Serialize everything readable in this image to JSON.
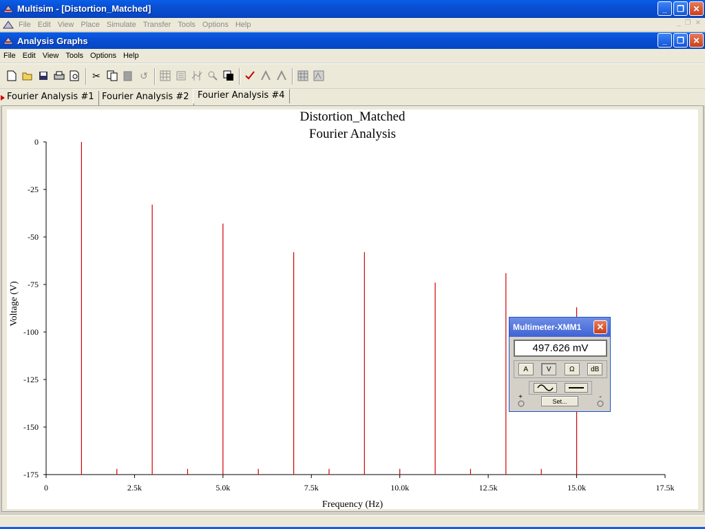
{
  "app": {
    "title": "Multisim - [Distortion_Matched]",
    "menu": [
      "File",
      "Edit",
      "View",
      "Place",
      "Simulate",
      "Transfer",
      "Tools",
      "Options",
      "Help"
    ]
  },
  "graph_window": {
    "title": "Analysis Graphs",
    "menu": [
      "File",
      "Edit",
      "View",
      "Tools",
      "Options",
      "Help"
    ],
    "tabs": [
      "Fourier Analysis #1",
      "Fourier Analysis #2",
      "Fourier Analysis #4"
    ],
    "active_tab": 2
  },
  "toolbar": {
    "buttons": [
      "new-icon",
      "open-icon",
      "save-icon",
      "print-icon",
      "print-preview-icon",
      "cut-icon",
      "copy-icon",
      "paste-icon",
      "undo-icon",
      "grid-icon",
      "legend-icon",
      "cursors-icon",
      "zoom-icon",
      "reverse-colors-icon",
      "overlay-traces-icon",
      "add-trace-icon",
      "remove-trace-icon",
      "export-excel-icon",
      "export-mathcad-icon"
    ]
  },
  "chart_data": {
    "type": "bar",
    "title": "Distortion_Matched",
    "subtitle": "Fourier Analysis",
    "xlabel": "Frequency (Hz)",
    "ylabel": "Voltage (V)",
    "xlim": [
      0,
      17500
    ],
    "ylim": [
      -175,
      0
    ],
    "xticks": [
      0,
      2500,
      5000,
      7500,
      10000,
      12500,
      15000,
      17500
    ],
    "xtick_labels": [
      "0",
      "2.5k",
      "5.0k",
      "7.5k",
      "10.0k",
      "12.5k",
      "15.0k",
      "17.5k"
    ],
    "yticks": [
      0,
      -25,
      -50,
      -75,
      -100,
      -125,
      -150,
      -175
    ],
    "ytick_labels": [
      "0",
      "-25",
      "-50",
      "-75",
      "-100",
      "-125",
      "-150",
      "-175"
    ],
    "series": [
      {
        "color": "#cc0000",
        "x": [
          1000,
          2000,
          3000,
          4000,
          5000,
          6000,
          7000,
          8000,
          9000,
          10000,
          11000,
          12000,
          13000,
          14000,
          15000
        ],
        "values": [
          0,
          -172,
          -33,
          -172,
          -43,
          -172,
          -58,
          -172,
          -58,
          -172,
          -74,
          -172,
          -69,
          -172,
          -87
        ]
      }
    ],
    "grid": false
  },
  "multimeter": {
    "title": "Multimeter-XMM1",
    "reading": "497.626 mV",
    "buttons": [
      "A",
      "V",
      "Ω",
      "dB"
    ],
    "selected": "V",
    "set_label": "Set...",
    "plus": "+",
    "minus": "-"
  }
}
